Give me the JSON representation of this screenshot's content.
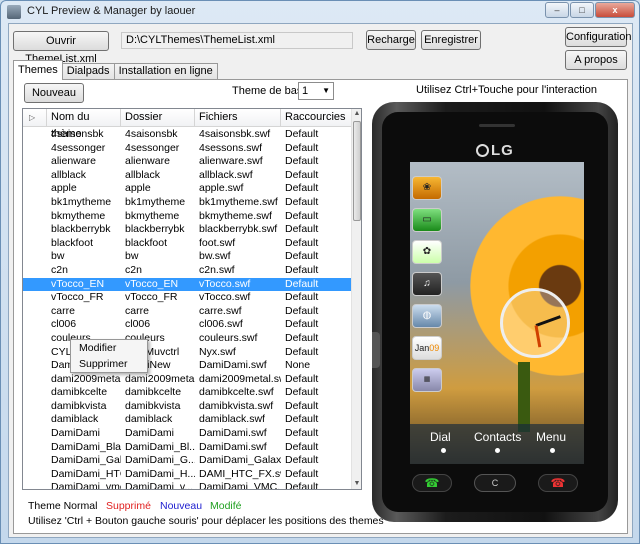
{
  "window": {
    "title": "CYL Preview & Manager by laouer",
    "controls": [
      "–",
      "□",
      "x"
    ]
  },
  "toolbar": {
    "open_label": "Ouvrir ThemeList.xml",
    "path_value": "D:\\CYLThemes\\ThemeList.xml",
    "recharge_label": "Recharge",
    "save_label": "Enregistrer",
    "config_label": "Configuration",
    "about_label": "A propos"
  },
  "tabs": [
    {
      "label": "Themes",
      "active": true
    },
    {
      "label": "Dialpads",
      "active": false
    },
    {
      "label": "Installation en ligne",
      "active": false
    }
  ],
  "themes_panel": {
    "new_label": "Nouveau",
    "theme_base_label": "Theme de base",
    "theme_base_value": "1",
    "hint_top": "Utilisez Ctrl+Touche pour l'interaction",
    "columns": [
      "Nom du thème",
      "Dossier",
      "Fichiers",
      "Raccourcies"
    ],
    "sort_icon": "sort-arrow-icon",
    "rows": [
      [
        "4saisonsbk",
        "4saisonsbk",
        "4saisonsbk.swf",
        "Default"
      ],
      [
        "4sessonger",
        "4sessonger",
        "4sessons.swf",
        "Default"
      ],
      [
        "alienware",
        "alienware",
        "alienware.swf",
        "Default"
      ],
      [
        "allblack",
        "allblack",
        "allblack.swf",
        "Default"
      ],
      [
        "apple",
        "apple",
        "apple.swf",
        "Default"
      ],
      [
        "bk1mytheme",
        "bk1mytheme",
        "bk1mytheme.swf",
        "Default"
      ],
      [
        "bkmytheme",
        "bkmytheme",
        "bkmytheme.swf",
        "Default"
      ],
      [
        "blackberrybk",
        "blackberrybk",
        "blackberrybk.swf",
        "Default"
      ],
      [
        "blackfoot",
        "blackfoot",
        "foot.swf",
        "Default"
      ],
      [
        "bw",
        "bw",
        "bw.swf",
        "Default"
      ],
      [
        "c2n",
        "c2n",
        "c2n.swf",
        "Default"
      ],
      [
        "vTocco_EN",
        "vTocco_EN",
        "vTocco.swf",
        "Default"
      ],
      [
        "vTocco_FR",
        "vTocco_FR",
        "vTocco.swf",
        "Default"
      ],
      [
        "carre",
        "carre",
        "carre.swf",
        "Default"
      ],
      [
        "cl006",
        "cl006",
        "cl006.swf",
        "Default"
      ],
      [
        "couleurs",
        "couleurs",
        "couleurs.swf",
        "Default"
      ],
      [
        "CYLMuvctrl",
        "CYLMuvctrl",
        "Nyx.swf",
        "Default"
      ],
      [
        "DamiNew",
        "DamiNew",
        "DamiDami.swf",
        "None"
      ],
      [
        "dami2009metal",
        "dami2009metal",
        "dami2009metal.swf",
        "Default"
      ],
      [
        "damibkcelte",
        "damibkcelte",
        "damibkcelte.swf",
        "Default"
      ],
      [
        "damibkvista",
        "damibkvista",
        "damibkvista.swf",
        "Default"
      ],
      [
        "damiblack",
        "damiblack",
        "damiblack.swf",
        "Default"
      ],
      [
        "DamiDami",
        "DamiDami",
        "DamiDami.swf",
        "Default"
      ],
      [
        "DamiDami_Bla...",
        "DamiDami_Bl...",
        "DamiDami.swf",
        "Default"
      ],
      [
        "DamiDami_Gal...",
        "DamiDami_G...",
        "DamiDami_Galax...",
        "Default"
      ],
      [
        "DamiDami_HTC",
        "DamiDami_H...",
        "DAMI_HTC_FX.swf",
        "Default"
      ],
      [
        "DamiDami_vmc",
        "DamiDami_v...",
        "DamiDami_VMC...",
        "Default"
      ]
    ],
    "selected_row": 11,
    "context_menu": [
      "Modifier",
      "Supprimer"
    ],
    "legend": {
      "normal": "Theme Normal",
      "deleted": "Supprimé",
      "new": "Nouveau",
      "modified": "Modifé"
    },
    "legend_colors": {
      "normal": "#000000",
      "deleted": "#e02020",
      "new": "#2020d0",
      "modified": "#20a020"
    },
    "hint_bottom": "Utilisez 'Ctrl + Bouton gauche souris' pour déplacer les positions des themes"
  },
  "phone": {
    "brand": "LG",
    "menu": [
      "Dial",
      "Contacts",
      "Menu"
    ],
    "c_key": "C",
    "calendar": "Jan",
    "calendar_day": "09"
  }
}
